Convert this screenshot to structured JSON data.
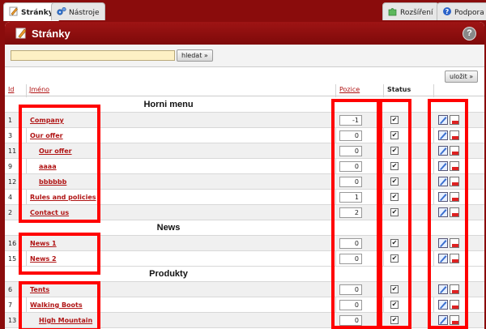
{
  "tabs": [
    {
      "label": "Stránky",
      "icon": "pencil-icon",
      "active": true
    },
    {
      "label": "Nástroje",
      "icon": "gears-icon",
      "active": false
    },
    {
      "label": "Rozšíření",
      "icon": "puzzle-icon",
      "active": false
    },
    {
      "label": "Podpora",
      "icon": "help-icon",
      "active": false
    }
  ],
  "panel": {
    "title": "Stránky",
    "help": "?"
  },
  "search": {
    "value": "",
    "button": "hledat »"
  },
  "toolbar": {
    "save": "uložit »"
  },
  "columns": {
    "id": "Id",
    "name": "Jméno",
    "position": "Pozice",
    "status": "Status"
  },
  "groups": [
    "Horni menu",
    "News",
    "Produkty"
  ],
  "rows": [
    {
      "id": "1",
      "name": "Company",
      "position": "-1",
      "status": "✔"
    },
    {
      "id": "3",
      "name": "Our offer",
      "position": "0",
      "status": "✔"
    },
    {
      "id": "11",
      "name": "Our offer",
      "position": "0",
      "status": "✔"
    },
    {
      "id": "9",
      "name": "aaaa",
      "position": "0",
      "status": "✔"
    },
    {
      "id": "12",
      "name": "bbbbbb",
      "position": "0",
      "status": "✔"
    },
    {
      "id": "4",
      "name": "Rules and policies",
      "position": "1",
      "status": "✔"
    },
    {
      "id": "2",
      "name": "Contact us",
      "position": "2",
      "status": "✔"
    },
    {
      "id": "16",
      "name": "News 1",
      "position": "0",
      "status": "✔"
    },
    {
      "id": "15",
      "name": "News 2",
      "position": "0",
      "status": "✔"
    },
    {
      "id": "6",
      "name": "Tents",
      "position": "0",
      "status": "✔"
    },
    {
      "id": "7",
      "name": "Walking Boots",
      "position": "0",
      "status": "✔"
    },
    {
      "id": "13",
      "name": "High Mountain",
      "position": "0",
      "status": "✔"
    }
  ],
  "colors": {
    "brand": "#8a0c0c",
    "link": "#b01414",
    "highlight": "#ff0000"
  }
}
